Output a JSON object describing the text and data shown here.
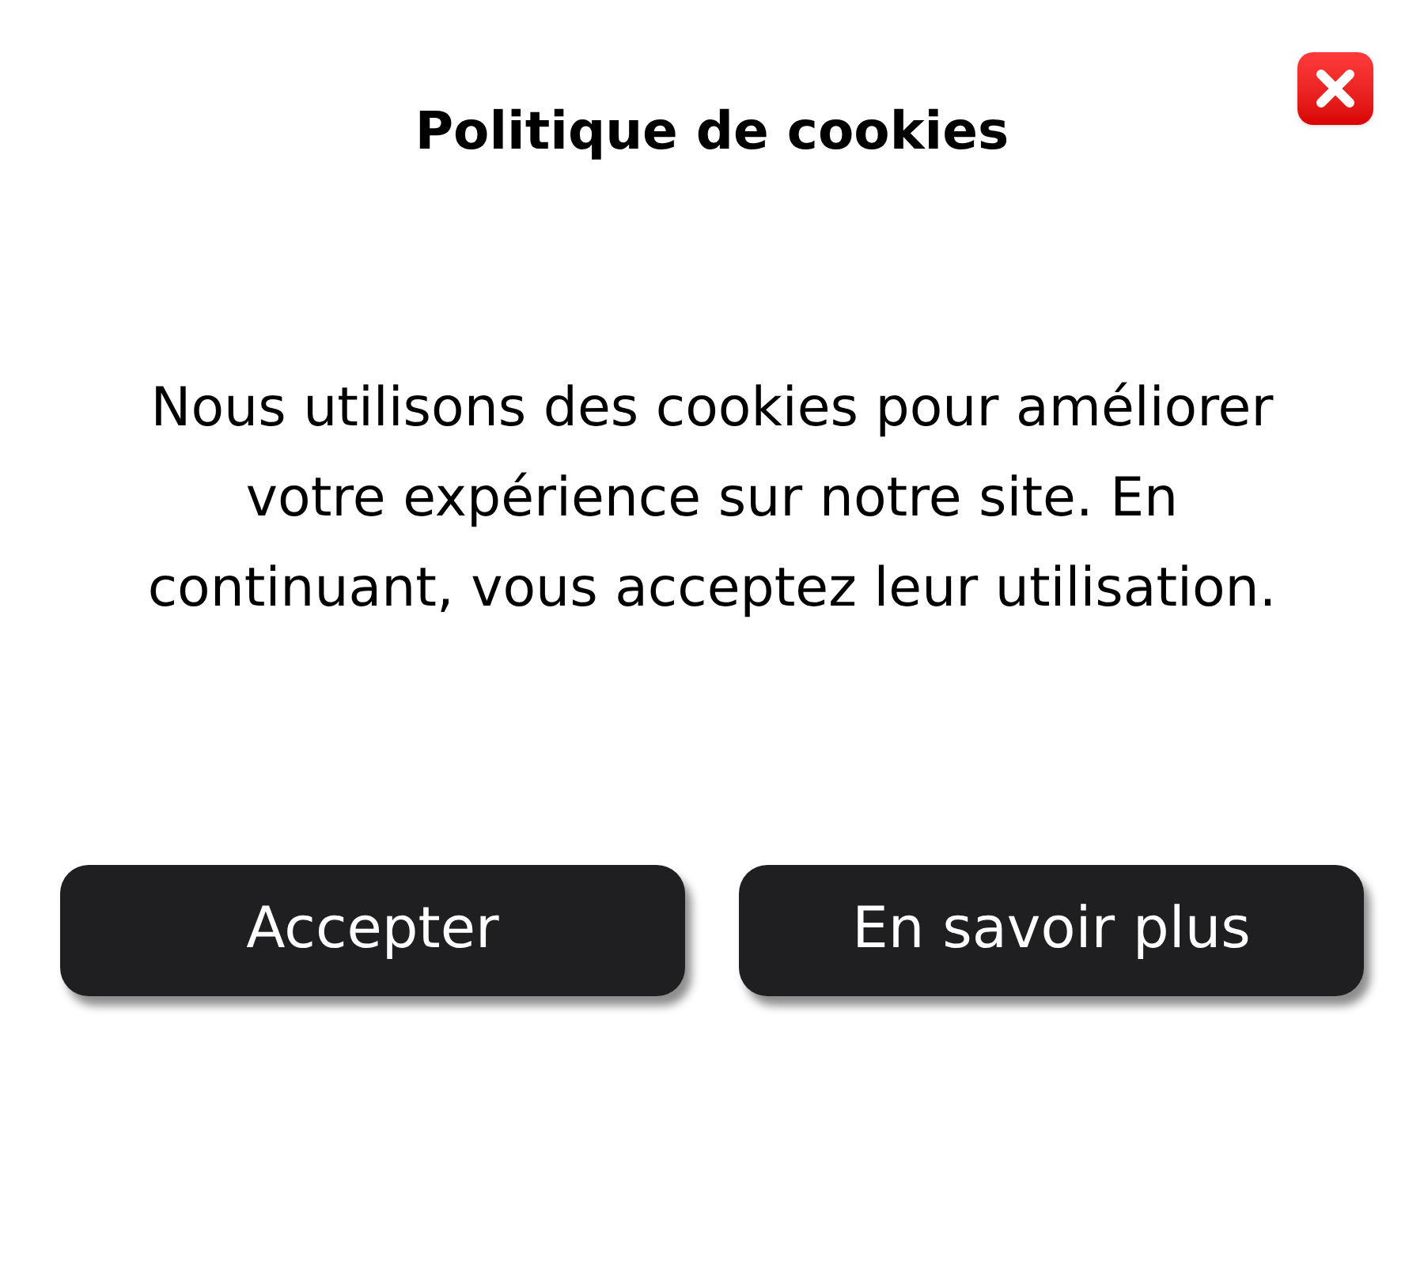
{
  "dialog": {
    "title": "Politique de cookies",
    "message": "Nous utilisons des cookies pour améliorer votre expérience sur notre site. En continuant, vous acceptez leur utilisation."
  },
  "buttons": [
    "Accepter",
    "En savoir plus"
  ]
}
